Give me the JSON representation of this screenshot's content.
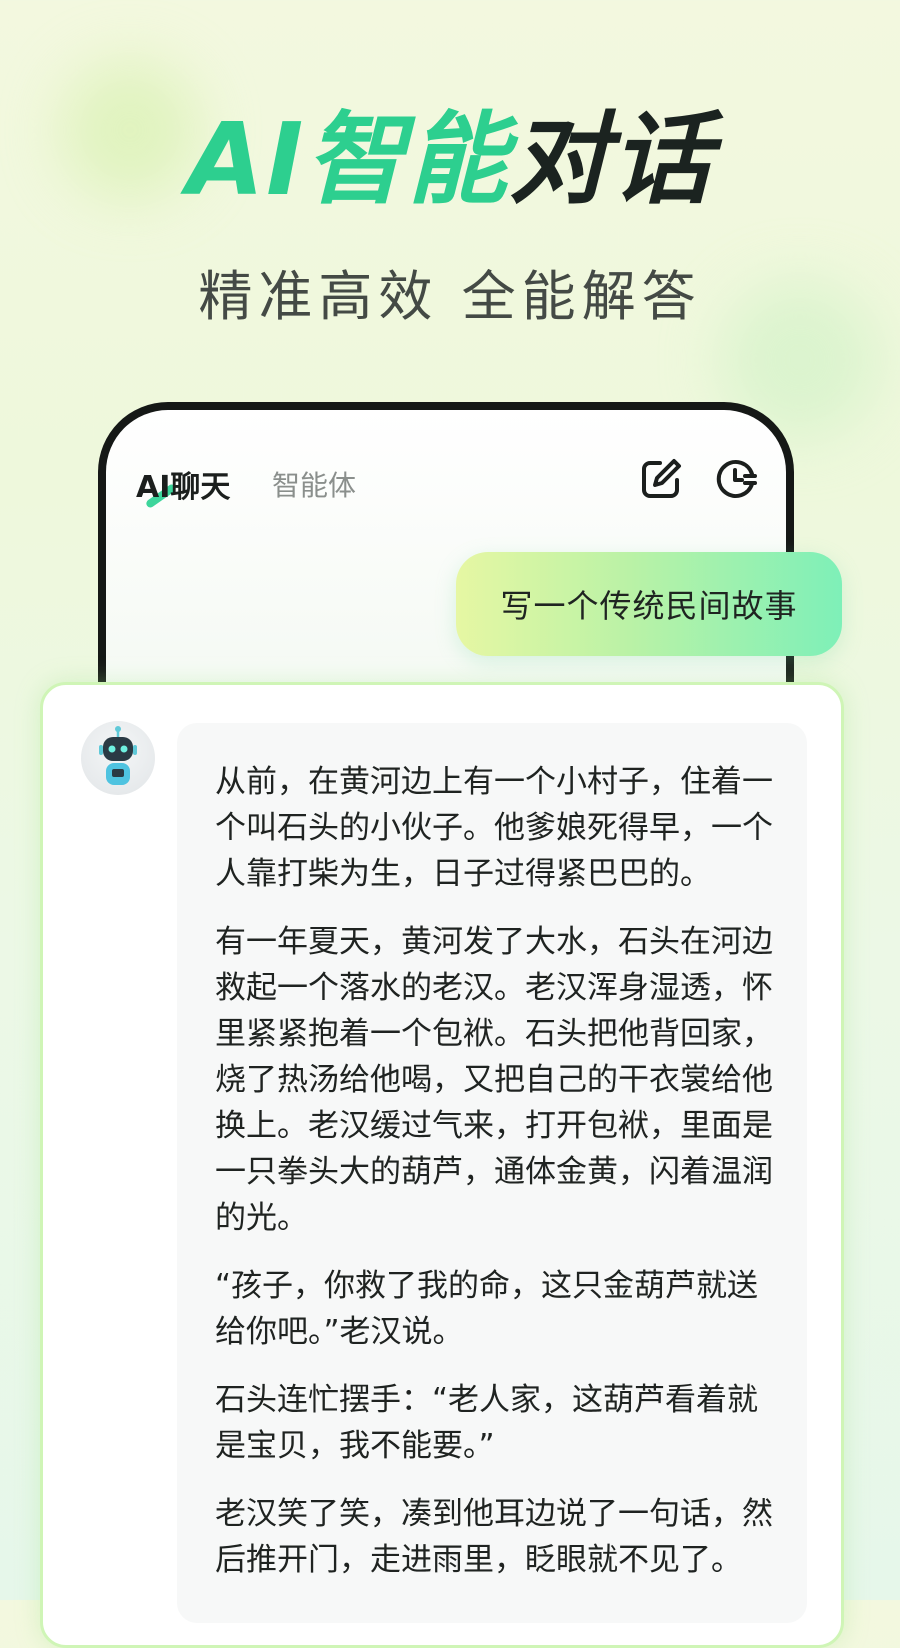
{
  "hero": {
    "title_green": "AI智能",
    "title_dark": "对话",
    "subtitle": "精准高效 全能解答"
  },
  "header": {
    "tab_chat": "AI聊天",
    "tab_agent": "智能体",
    "icons": [
      "edit-icon",
      "history-icon"
    ]
  },
  "user_message": "写一个传统民间故事",
  "reply": {
    "paragraphs": [
      "从前，在黄河边上有一个小村子，住着一个叫石头的小伙子。他爹娘死得早，一个人靠打柴为生，日子过得紧巴巴的。",
      "有一年夏天，黄河发了大水，石头在河边救起一个落水的老汉。老汉浑身湿透，怀里紧紧抱着一个包袱。石头把他背回家，烧了热汤给他喝，又把自己的干衣裳给他换上。老汉缓过气来，打开包袱，里面是一只拳头大的葫芦，通体金黄，闪着温润的光。",
      "“孩子，你救了我的命，这只金葫芦就送给你吧。”老汉说。",
      "石头连忙摆手：“老人家，这葫芦看着就是宝贝，我不能要。”",
      "老汉笑了笑，凑到他耳边说了一句话，然后推开门，走进雨里，眨眼就不见了。"
    ]
  },
  "colors": {
    "accent_green": "#2dcf8f",
    "dark": "#1b2320",
    "bubble_start": "#e6f7a3",
    "bubble_end": "#7ef0b8"
  }
}
